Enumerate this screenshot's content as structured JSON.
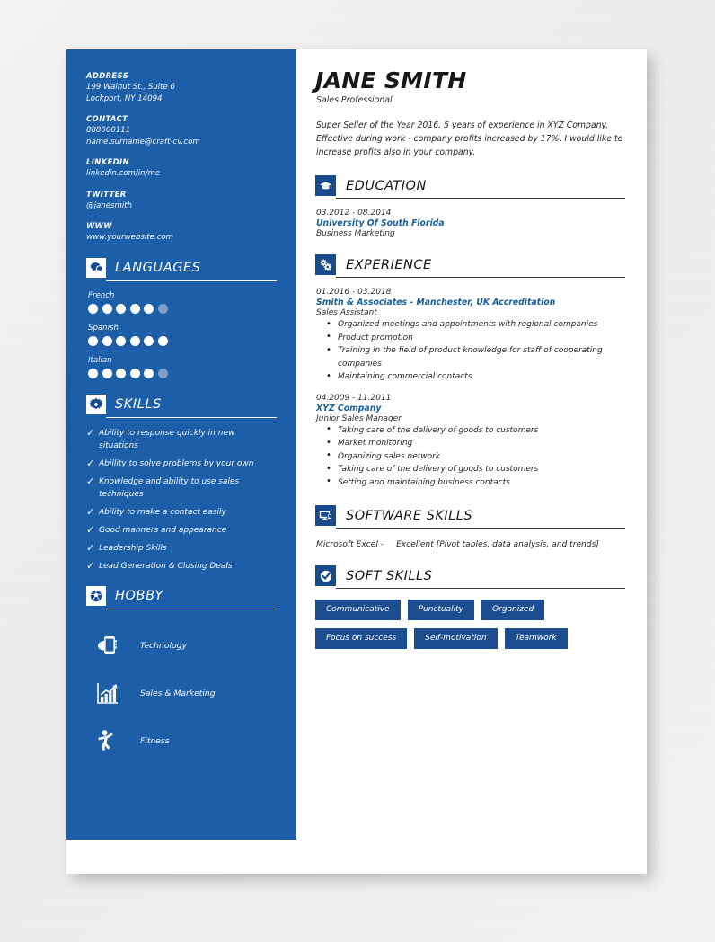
{
  "sidebar": {
    "contact_blocks": [
      {
        "label": "ADDRESS",
        "lines": [
          "199 Walnut St., Suite 6",
          "Lockport, NY 14094"
        ]
      },
      {
        "label": "CONTACT",
        "lines": [
          "888000111",
          "name.surname@craft-cv.com"
        ]
      },
      {
        "label": "LINKEDIN",
        "lines": [
          "linkedin.com/in/me"
        ]
      },
      {
        "label": "TWITTER",
        "lines": [
          "@janesmith"
        ]
      },
      {
        "label": "WWW",
        "lines": [
          "www.yourwebsite.com"
        ]
      }
    ],
    "languages": {
      "title": "LANGUAGES",
      "icon": "speech-bubbles-icon",
      "total_dots": 6,
      "items": [
        {
          "name": "French",
          "filled": 5
        },
        {
          "name": "Spanish",
          "filled": 6
        },
        {
          "name": "Italian",
          "filled": 5
        }
      ]
    },
    "skills": {
      "title": "SKILLS",
      "icon": "puzzle-piece-icon",
      "check_glyph": "✓",
      "items": [
        "Ability to response quickly in new situations",
        "Abillity to solve problems by your own",
        "Knowledge and ability to use sales techniques",
        "Ability to make a contact easily",
        "Good manners and appearance",
        "Leadership Skills",
        "Lead Generation & Closing Deals"
      ]
    },
    "hobby": {
      "title": "HOBBY",
      "icon": "soccer-ball-icon",
      "items": [
        {
          "label": "Technology",
          "icon": "smartphone-icon"
        },
        {
          "label": "Sales & Marketing",
          "icon": "bar-chart-growth-icon"
        },
        {
          "label": "Fitness",
          "icon": "dancer-figure-icon"
        }
      ]
    }
  },
  "main": {
    "name": "JANE SMITH",
    "role": "Sales Professional",
    "summary": "Super Seller of the Year 2016. 5 years of experience in XYZ Company. Effective during work - company profits increased by 17%. I would like to increase profits also in your company.",
    "education": {
      "title": "EDUCATION",
      "icon": "graduation-cap-icon",
      "entries": [
        {
          "date": "03.2012 - 08.2014",
          "org": "University Of South Florida",
          "role": "Business Marketing",
          "bullets": []
        }
      ]
    },
    "experience": {
      "title": "EXPERIENCE",
      "icon": "gears-icon",
      "entries": [
        {
          "date": "01.2016 - 03.2018",
          "org": "Smith & Associates - Manchester, UK Accreditation",
          "role": "Sales Assistant",
          "bullets": [
            "Organized meetings and appointments with regional companies",
            "Product promotion",
            "Training in the field of product knowledge for staff of cooperating companies",
            "Maintaining commercial contacts"
          ]
        },
        {
          "date": "04.2009 - 11.2011",
          "org": "XYZ Company",
          "role": "Junior Sales Manager",
          "bullets": [
            "Taking care of the delivery of goods to customers",
            "Market monitoring",
            "Organizing sales network",
            "Taking care of the delivery of goods to customers",
            "Setting and maintaining business contacts"
          ]
        }
      ]
    },
    "software_skills": {
      "title": "SOFTWARE SKILLS",
      "icon": "monitor-icon",
      "item_name": "Microsoft Excel -",
      "item_value": "Excellent [Pivot tables, data analysis, and trends]"
    },
    "soft_skills": {
      "title": "SOFT SKILLS",
      "icon": "check-circle-icon",
      "rows": [
        [
          "Communicative",
          "Punctuality",
          "Organized"
        ],
        [
          "Focus on success",
          "Self-motivation",
          "Teamwork"
        ]
      ]
    }
  },
  "colors": {
    "sidebar_blue": "#1c5fa8",
    "icon_navy": "#184b8c",
    "chip_navy": "#1c4e8f",
    "accent_link": "#17619e",
    "dot_off": "#7e9dc4",
    "page_white": "#ffffff",
    "backdrop": "#f2f1ef"
  }
}
